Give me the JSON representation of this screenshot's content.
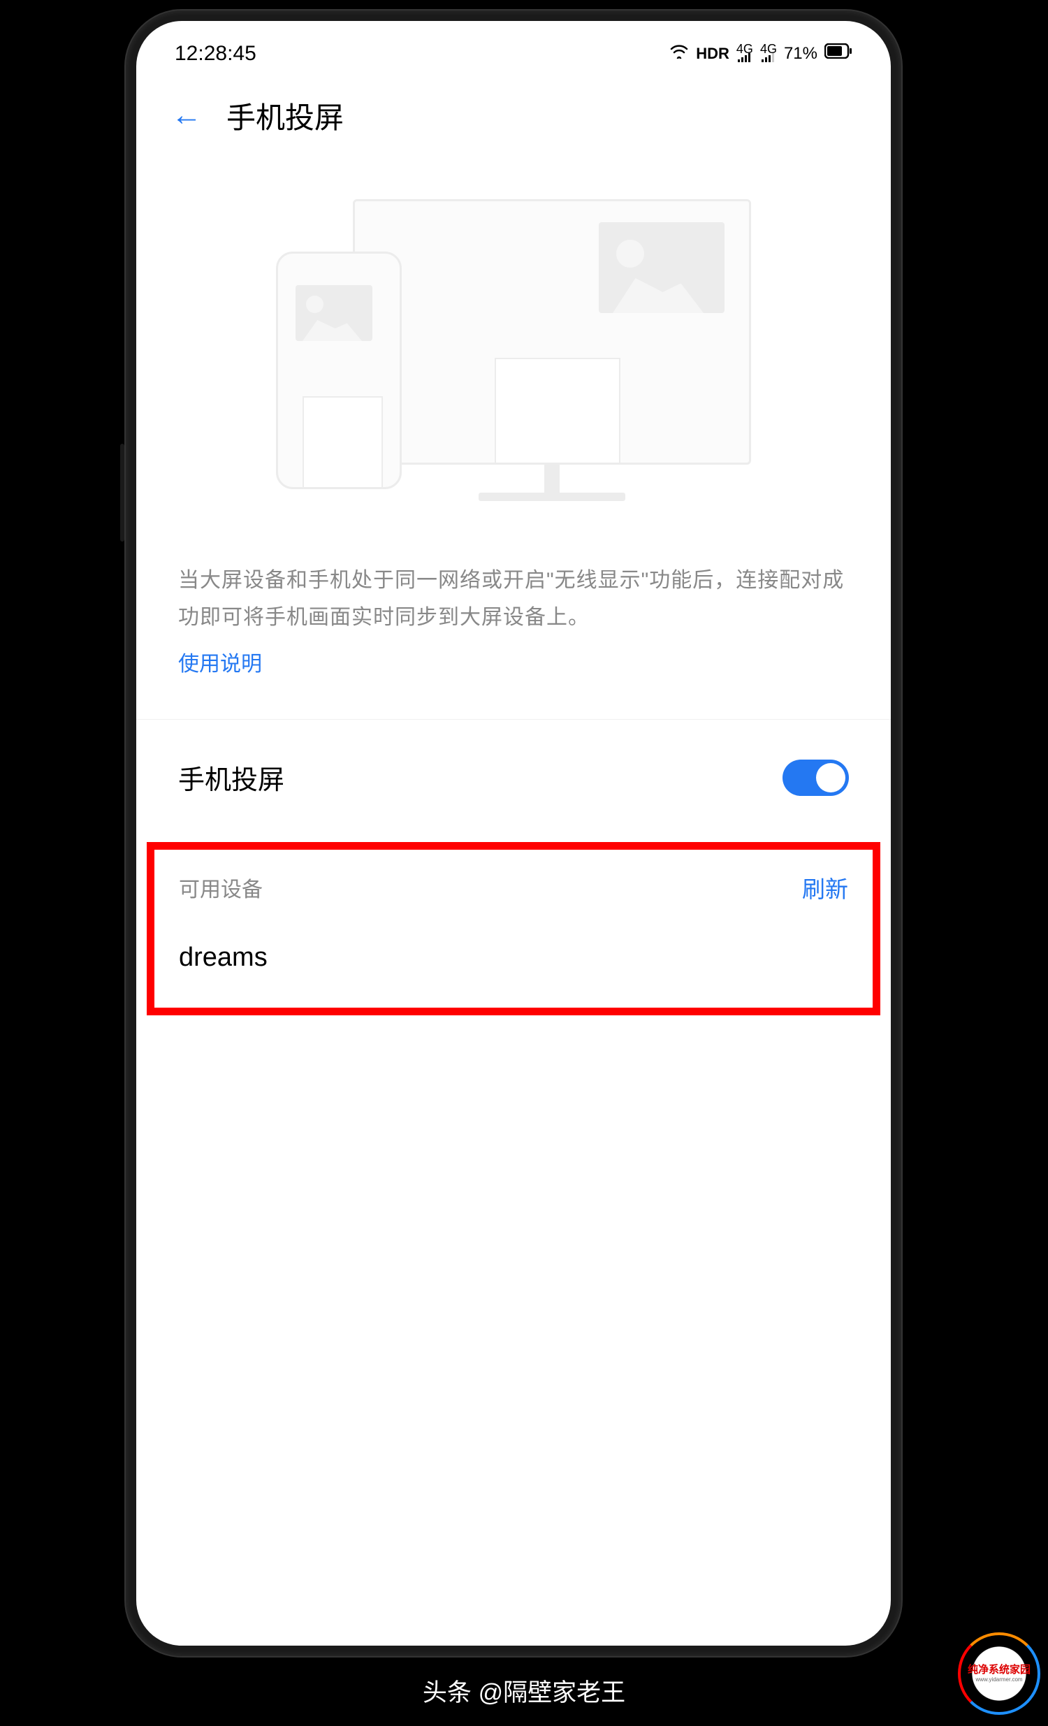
{
  "status_bar": {
    "time": "12:28:45",
    "hd_label": "HDR",
    "signal1_label": "4G",
    "signal2_label": "4G",
    "battery_percent": "71%"
  },
  "nav": {
    "title": "手机投屏"
  },
  "main": {
    "description": "当大屏设备和手机处于同一网络或开启\"无线显示\"功能后，连接配对成功即可将手机画面实时同步到大屏设备上。",
    "help_link": "使用说明",
    "toggle_label": "手机投屏",
    "toggle_on": true
  },
  "devices": {
    "section_label": "可用设备",
    "refresh_label": "刷新",
    "list": [
      {
        "name": "dreams"
      }
    ]
  },
  "footer": {
    "caption": "头条 @隔壁家老王",
    "watermark_text": "纯净系统家园",
    "watermark_sub": "www.yidarmer.com"
  }
}
